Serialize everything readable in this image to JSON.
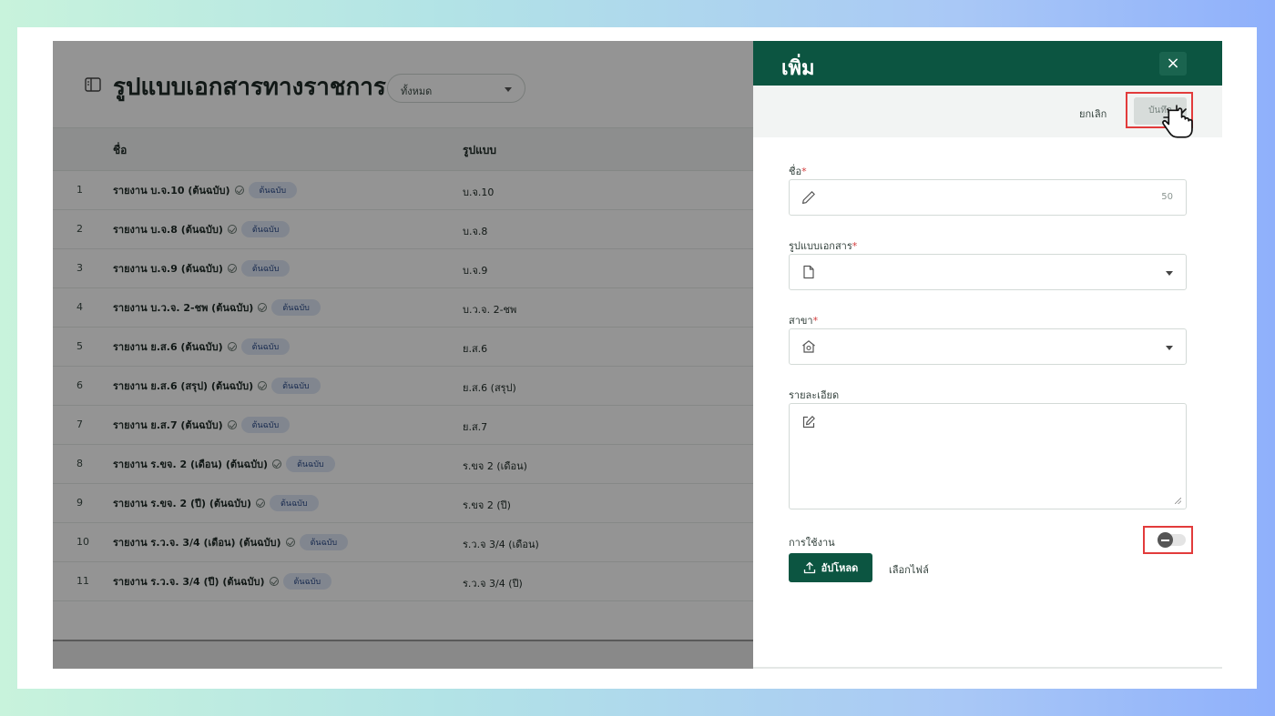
{
  "page": {
    "title": "รูปแบบเอกสารทางราชการ",
    "filter_value": "ทั้งหมด",
    "columns": {
      "name": "ชื่อ",
      "format": "รูปแบบ"
    },
    "rows": [
      {
        "index": "1",
        "name": "รายงาน บ.จ.10 (ต้นฉบับ)",
        "badge": "ต้นฉบับ",
        "format": "บ.จ.10"
      },
      {
        "index": "2",
        "name": "รายงาน บ.จ.8 (ต้นฉบับ)",
        "badge": "ต้นฉบับ",
        "format": "บ.จ.8"
      },
      {
        "index": "3",
        "name": "รายงาน บ.จ.9 (ต้นฉบับ)",
        "badge": "ต้นฉบับ",
        "format": "บ.จ.9"
      },
      {
        "index": "4",
        "name": "รายงาน บ.ว.จ. 2-ชพ (ต้นฉบับ)",
        "badge": "ต้นฉบับ",
        "format": "บ.ว.จ. 2-ชพ"
      },
      {
        "index": "5",
        "name": "รายงาน ย.ส.6 (ต้นฉบับ)",
        "badge": "ต้นฉบับ",
        "format": "ย.ส.6"
      },
      {
        "index": "6",
        "name": "รายงาน ย.ส.6 (สรุป) (ต้นฉบับ)",
        "badge": "ต้นฉบับ",
        "format": "ย.ส.6 (สรุป)"
      },
      {
        "index": "7",
        "name": "รายงาน ย.ส.7 (ต้นฉบับ)",
        "badge": "ต้นฉบับ",
        "format": "ย.ส.7"
      },
      {
        "index": "8",
        "name": "รายงาน ร.ขจ. 2 (เดือน) (ต้นฉบับ)",
        "badge": "ต้นฉบับ",
        "format": "ร.ขจ 2 (เดือน)"
      },
      {
        "index": "9",
        "name": "รายงาน ร.ขจ. 2 (ปี) (ต้นฉบับ)",
        "badge": "ต้นฉบับ",
        "format": "ร.ขจ 2 (ปี)"
      },
      {
        "index": "10",
        "name": "รายงาน ร.ว.จ. 3/4 (เดือน) (ต้นฉบับ)",
        "badge": "ต้นฉบับ",
        "format": "ร.ว.จ 3/4 (เดือน)"
      },
      {
        "index": "11",
        "name": "รายงาน ร.ว.จ. 3/4 (ปี) (ต้นฉบับ)",
        "badge": "ต้นฉบับ",
        "format": "ร.ว.จ 3/4 (ปี)"
      }
    ]
  },
  "drawer": {
    "title": "เพิ่ม",
    "close_label": "×",
    "cancel_label": "ยกเลิก",
    "save_label": "บันทึก",
    "fields": {
      "name": {
        "label": "ชื่อ",
        "required_mark": "*",
        "value": "",
        "max_length": "50",
        "icon": "pencil-icon"
      },
      "document_format": {
        "label": "รูปแบบเอกสาร",
        "required_mark": "*",
        "value": "",
        "icon": "document-icon"
      },
      "branch": {
        "label": "สาขา",
        "required_mark": "*",
        "value": "",
        "icon": "branch-icon"
      },
      "details": {
        "label": "รายละเอียด",
        "value": "",
        "icon": "edit-icon"
      }
    },
    "usage": {
      "label": "การใช้งาน",
      "enabled": false
    },
    "upload_label": "อัปโหลด",
    "choose_file_label": "เลือกไฟล์"
  },
  "colors": {
    "brand": "#0c5541",
    "highlight": "#e23b3b",
    "badge_bg": "#dfe7f6",
    "badge_text": "#2c4c8a"
  }
}
